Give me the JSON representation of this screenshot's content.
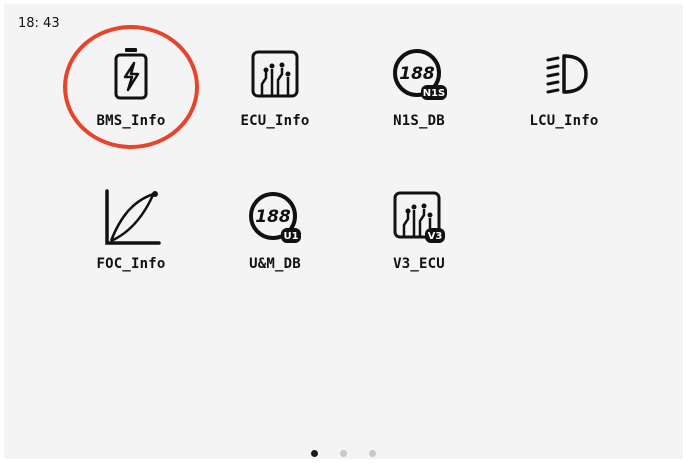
{
  "status_bar": {
    "time": "18: 43"
  },
  "apps": [
    {
      "label": "BMS_Info",
      "icon": "battery-bolt-icon"
    },
    {
      "label": "ECU_Info",
      "icon": "circuit-board-icon"
    },
    {
      "label": "N1S_DB",
      "icon": "speedometer-display-icon",
      "badge": "N1S"
    },
    {
      "label": "LCU_Info",
      "icon": "headlight-icon"
    },
    {
      "label": "FOC_Info",
      "icon": "curve-graph-icon"
    },
    {
      "label": "U&M_DB",
      "icon": "speedometer-display-icon",
      "badge": "U1"
    },
    {
      "label": "V3_ECU",
      "icon": "circuit-board-icon",
      "badge": "V3"
    }
  ],
  "display_digits": "188",
  "pager": {
    "pages": 3,
    "current": 1
  },
  "colors": {
    "highlight": "#e8442c",
    "icon": "#111111",
    "background": "#f4f4f4"
  }
}
